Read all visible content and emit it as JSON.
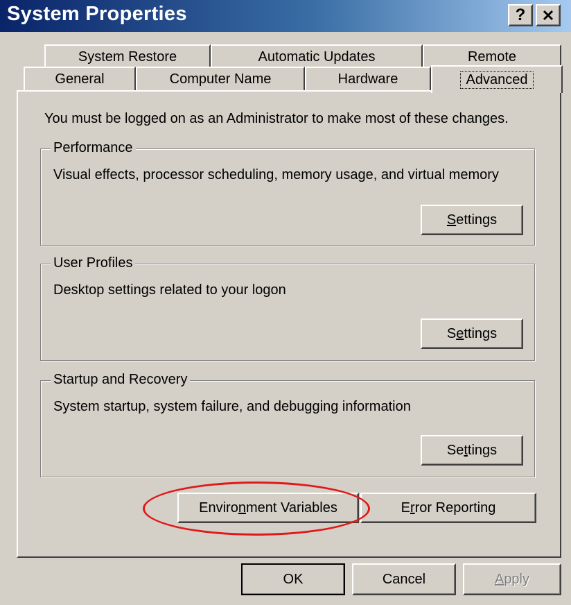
{
  "window": {
    "title": "System Properties",
    "help_label": "?",
    "close_label": "✕"
  },
  "tabs": {
    "row1": [
      "System Restore",
      "Automatic Updates",
      "Remote"
    ],
    "row2": [
      "General",
      "Computer Name",
      "Hardware",
      "Advanced"
    ],
    "active": "Advanced"
  },
  "panel": {
    "admin_note": "You must be logged on as an Administrator to make most of these changes."
  },
  "groups": {
    "performance": {
      "label": "Performance",
      "description": "Visual effects, processor scheduling, memory usage, and virtual memory",
      "button": "Settings"
    },
    "user_profiles": {
      "label": "User Profiles",
      "description": "Desktop settings related to your logon",
      "button": "Settings"
    },
    "startup_recovery": {
      "label": "Startup and Recovery",
      "description": "System startup, system failure, and debugging information",
      "button": "Settings"
    }
  },
  "buttons": {
    "environment_variables": "Environment Variables",
    "error_reporting": "Error Reporting",
    "ok": "OK",
    "cancel": "Cancel",
    "apply": "Apply"
  },
  "colors": {
    "title_gradient_start": "#0a246a",
    "title_gradient_end": "#a6caf0",
    "face": "#d4d0c8",
    "highlight_ellipse": "#e21818"
  }
}
